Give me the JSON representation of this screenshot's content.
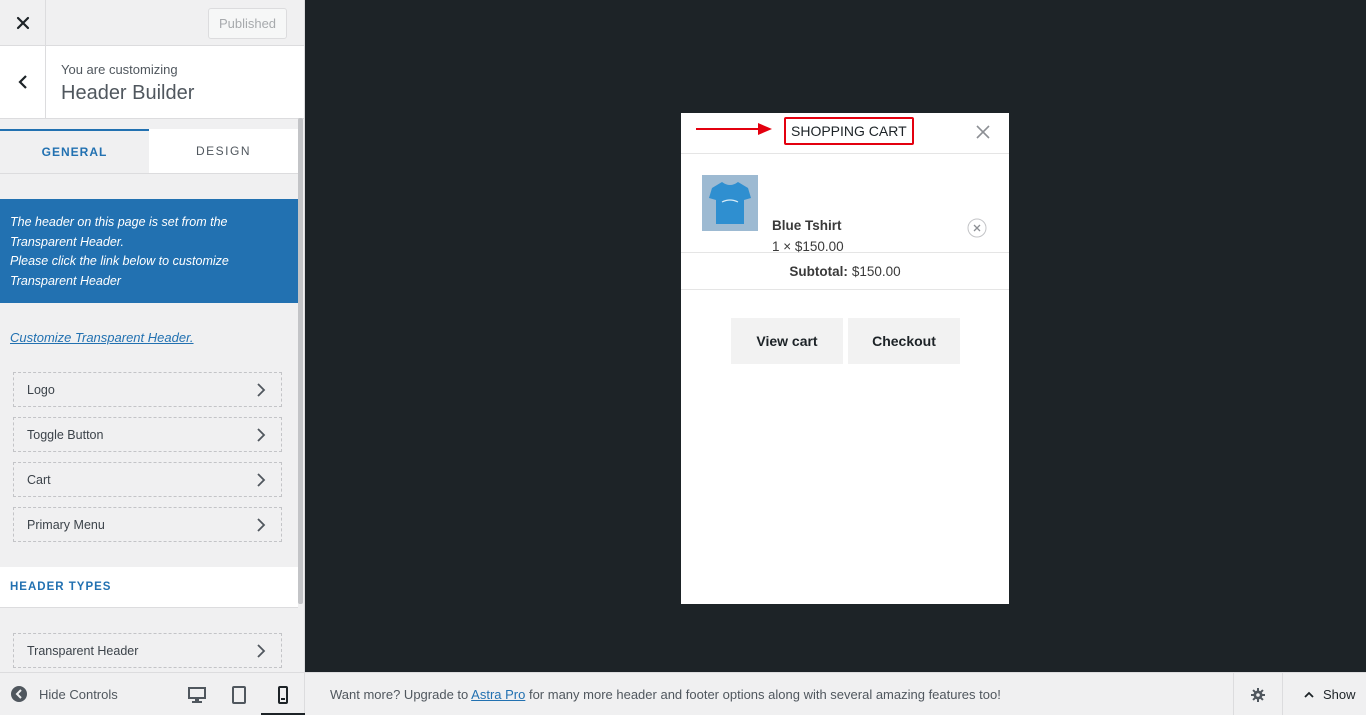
{
  "topbar": {
    "close_label": "✕",
    "publish_label": "Published"
  },
  "customizing": {
    "small": "You are customizing",
    "title": "Header Builder"
  },
  "tabs": [
    {
      "label": "GENERAL"
    },
    {
      "label": "DESIGN"
    }
  ],
  "notice": {
    "line1": "The header on this page is set from the",
    "line2": "Transparent Header.",
    "line3": "Please click the link below to customize",
    "line4": "Transparent Header"
  },
  "customize_link": "Customize Transparent Header.",
  "menu_items": [
    {
      "label": "Logo"
    },
    {
      "label": "Toggle Button"
    },
    {
      "label": "Cart"
    },
    {
      "label": "Primary Menu"
    }
  ],
  "section": {
    "header_types": "HEADER TYPES"
  },
  "header_types_items": [
    {
      "label": "Transparent Header"
    }
  ],
  "footer": {
    "hide_controls": "Hide Controls",
    "upgrade_pre": "Want more? Upgrade to ",
    "upgrade_link": "Astra Pro",
    "upgrade_post": " for many more header and footer options along with several amazing features too!",
    "show_label": "Show"
  },
  "cart": {
    "title": "SHOPPING CART",
    "item": {
      "name": "Blue Tshirt",
      "qty": "1 × $150.00"
    },
    "subtotal_label": "Subtotal:",
    "subtotal_value": "$150.00",
    "view_cart": "View cart",
    "checkout": "Checkout"
  },
  "colors": {
    "accent": "#2271b1",
    "highlight": "#e3000f",
    "preview_bg": "#1d2327"
  },
  "icons": [
    "close-icon",
    "back-chevron-icon",
    "chevron-right-icon",
    "eye-off-icon",
    "desktop-icon",
    "tablet-icon",
    "mobile-icon",
    "gear-icon",
    "chevron-up-icon",
    "arrow-right-icon",
    "remove-item-icon"
  ]
}
